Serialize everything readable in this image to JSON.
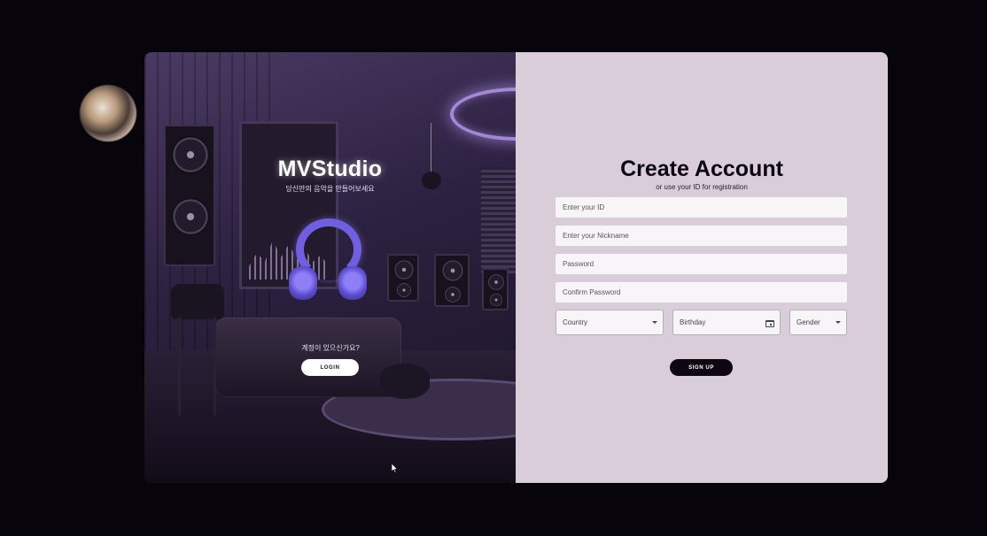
{
  "brand": {
    "title": "MVStudio",
    "subtitle": "당신만의 음악을 만들어보세요"
  },
  "login_section": {
    "prompt": "계정이 있으신가요?",
    "login_label": "LOGIN"
  },
  "register": {
    "title": "Create Account",
    "subtitle": "or use your ID for registration",
    "fields": {
      "id_placeholder": "Enter your ID",
      "nickname_placeholder": "Enter your Nickname",
      "password_placeholder": "Password",
      "confirm_placeholder": "Confirm Password"
    },
    "selects": {
      "country": "Country",
      "birthday": "Birthday",
      "gender": "Gender"
    },
    "signup_label": "SIGN UP"
  },
  "icons": {
    "country_caret": "chevron-down-icon",
    "birthday_calendar": "calendar-icon",
    "gender_caret": "chevron-down-icon",
    "mouse_pointer": "cursor-icon"
  },
  "colors": {
    "page_background": "#07040c",
    "form_panel": "#d9cdd9",
    "signup_button": "#0e0712",
    "login_button": "#ffffff",
    "headphone_accent": "#7060e0"
  }
}
